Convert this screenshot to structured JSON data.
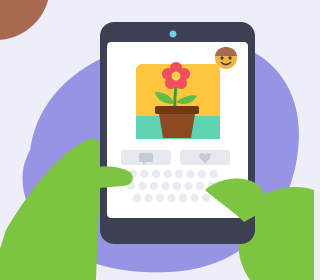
{
  "colors": {
    "background": "#eeeef8",
    "blob": "#9794e6",
    "blob_shade": "#7f7bd8",
    "corner_dot": "#a86a4e",
    "tablet_frame": "#3d3f52",
    "screen": "#ffffff",
    "camera": "#6fd0e6",
    "photo_bg": "#ffc53f",
    "photo_floor": "#5fd2b3",
    "flower_petals": "#f0505e",
    "flower_center": "#ffd24a",
    "stem": "#3f9a3f",
    "leaves": "#5bbd4a",
    "pot": "#8b4a22",
    "pot_rim": "#6f3718",
    "action_buttons": "#e6e8f0",
    "button_icons": "#c6c9d8",
    "keyboard_keys": "#e9ebf2",
    "hands": "#7dc443",
    "hands_shade": "#5ea82f",
    "avatar": "#f4b33c"
  },
  "icons": {
    "avatar": "smiling-avatar-icon",
    "comment": "speech-bubble-icon",
    "like": "heart-icon"
  },
  "keyboard": {
    "rows": 3,
    "keys_per_row": [
      8,
      8,
      7
    ]
  }
}
